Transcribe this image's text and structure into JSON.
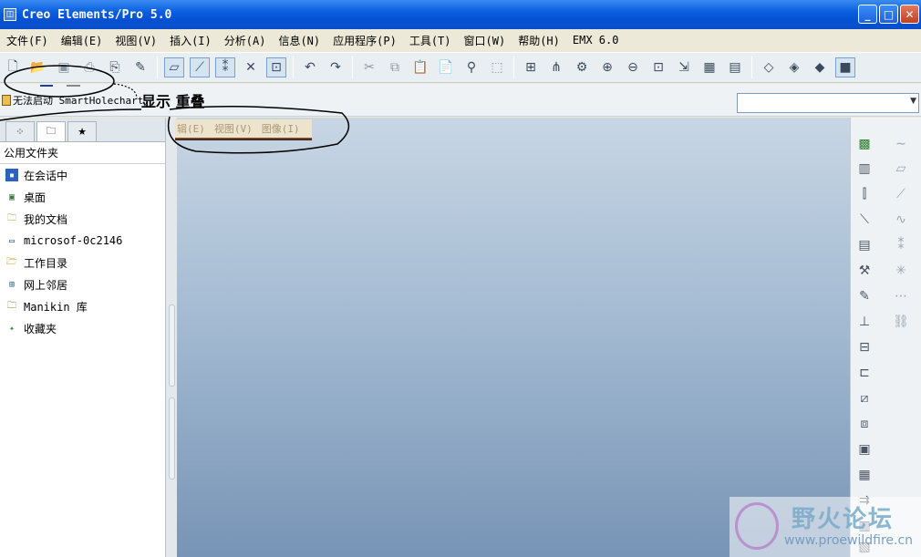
{
  "window": {
    "title": "Creo Elements/Pro 5.0"
  },
  "menu": [
    "文件(F)",
    "编辑(E)",
    "视图(V)",
    "插入(I)",
    "分析(A)",
    "信息(N)",
    "应用程序(P)",
    "工具(T)",
    "窗口(W)",
    "帮助(H)",
    "EMX 6.0"
  ],
  "message": "无法启动 SmartHolechart.",
  "annotation": "显示 重叠",
  "folder_header": "公用文件夹",
  "folders": [
    {
      "label": "在会话中",
      "icon": "session-icon"
    },
    {
      "label": "桌面",
      "icon": "desktop-icon"
    },
    {
      "label": "我的文档",
      "icon": "my-documents-icon"
    },
    {
      "label": "microsof-0c2146",
      "icon": "computer-icon"
    },
    {
      "label": "工作目录",
      "icon": "working-dir-icon"
    },
    {
      "label": "网上邻居",
      "icon": "network-icon"
    },
    {
      "label": "Manikin 库",
      "icon": "manikin-icon"
    },
    {
      "label": "收藏夹",
      "icon": "favorites-icon"
    }
  ],
  "overlay_menu": [
    "辑(E)",
    "视图(V)",
    "图像(I)"
  ],
  "watermark": {
    "title": "野火论坛",
    "url": "www.proewildfire.cn"
  }
}
